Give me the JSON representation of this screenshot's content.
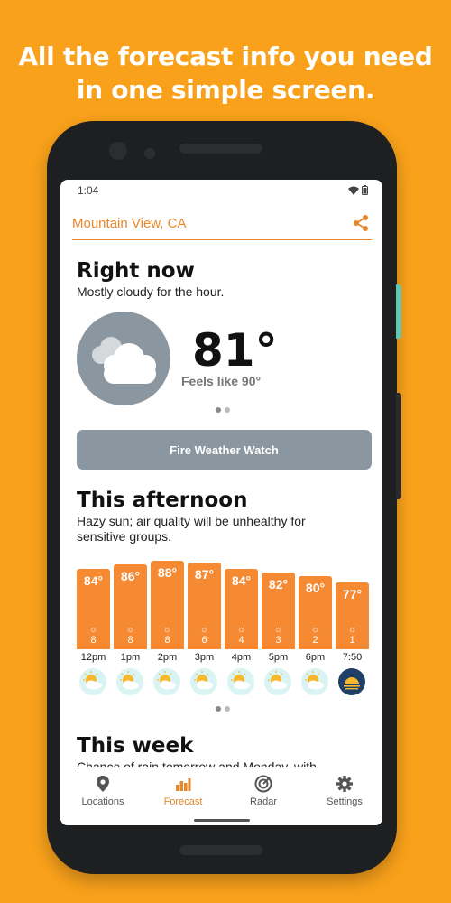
{
  "headline": {
    "line1": "All the forecast info you need",
    "line2": "in one simple screen."
  },
  "status_bar": {
    "time": "1:04"
  },
  "location": {
    "name": "Mountain View, CA"
  },
  "right_now": {
    "title": "Right now",
    "summary": "Mostly cloudy for the hour.",
    "temp": "81°",
    "feels_like": "Feels like 90°",
    "icon": "cloud-icon"
  },
  "alert": {
    "label": "Fire Weather Watch"
  },
  "afternoon": {
    "title": "This afternoon",
    "summary": "Hazy sun; air quality will be unhealthy for sensitive groups.",
    "hours": [
      {
        "time": "12pm",
        "temp": "84°",
        "uv": "8",
        "temp_value": 84,
        "icon": "hazy-sun-icon"
      },
      {
        "time": "1pm",
        "temp": "86°",
        "uv": "8",
        "temp_value": 86,
        "icon": "hazy-sun-icon"
      },
      {
        "time": "2pm",
        "temp": "88°",
        "uv": "8",
        "temp_value": 88,
        "icon": "hazy-sun-icon"
      },
      {
        "time": "3pm",
        "temp": "87°",
        "uv": "6",
        "temp_value": 87,
        "icon": "hazy-sun-icon"
      },
      {
        "time": "4pm",
        "temp": "84°",
        "uv": "4",
        "temp_value": 84,
        "icon": "hazy-sun-icon"
      },
      {
        "time": "5pm",
        "temp": "82°",
        "uv": "3",
        "temp_value": 82,
        "icon": "hazy-sun-icon"
      },
      {
        "time": "6pm",
        "temp": "80°",
        "uv": "2",
        "temp_value": 80,
        "icon": "hazy-sun-icon"
      },
      {
        "time": "7:50",
        "temp": "77°",
        "uv": "1",
        "temp_value": 77,
        "icon": "sunset-icon"
      }
    ]
  },
  "week": {
    "title": "This week",
    "summary": "Chance of rain tomorrow and Monday, with"
  },
  "tabs": [
    {
      "label": "Locations",
      "icon": "location-pin-icon",
      "active": false
    },
    {
      "label": "Forecast",
      "icon": "bar-chart-icon",
      "active": true
    },
    {
      "label": "Radar",
      "icon": "radar-icon",
      "active": false
    },
    {
      "label": "Settings",
      "icon": "gear-icon",
      "active": false
    }
  ],
  "colors": {
    "background": "#F9A11B",
    "accent": "#E8872A",
    "bar": "#F58A32",
    "alert": "#8a96a0"
  }
}
